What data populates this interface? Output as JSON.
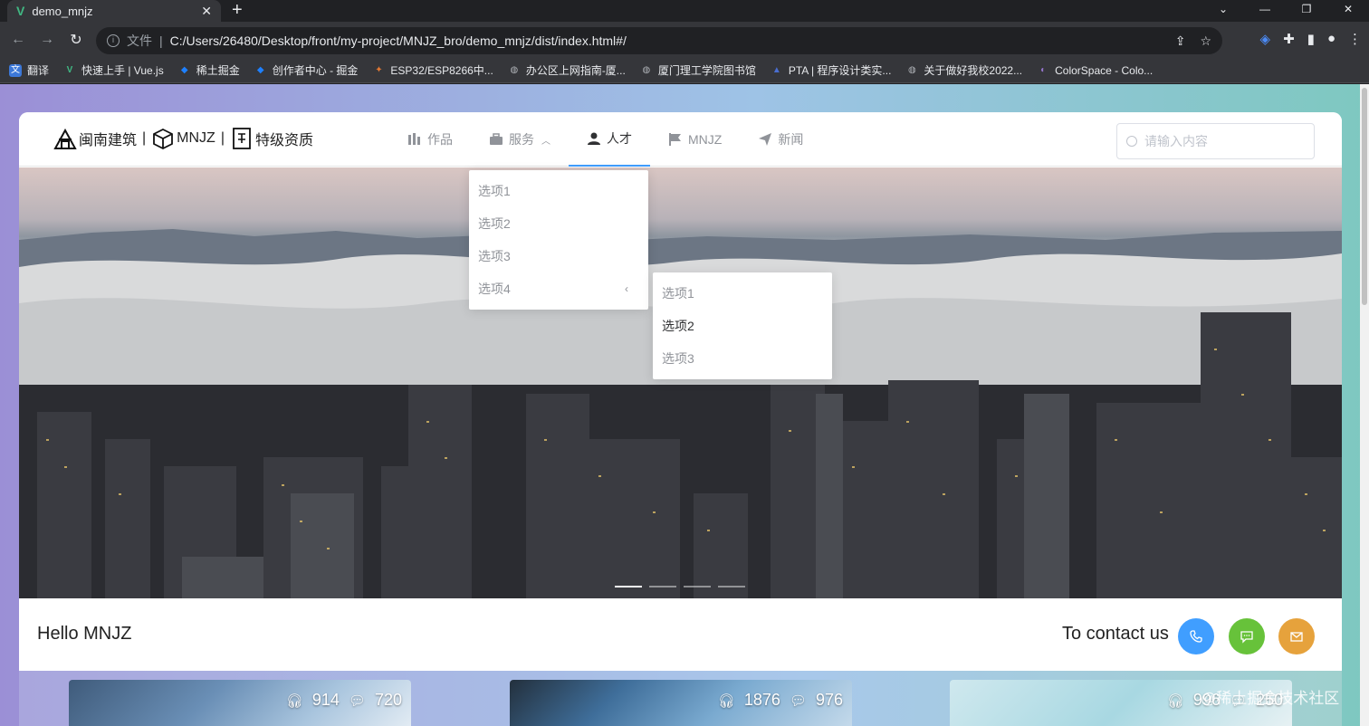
{
  "browser": {
    "tab_title": "demo_mnjz",
    "new_tab": "+",
    "omnibox_scheme": "文件",
    "url": "C:/Users/26480/Desktop/front/my-project/MNJZ_bro/demo_mnjz/dist/index.html#/",
    "bookmarks": [
      {
        "label": "翻译",
        "color": "#3c78d8"
      },
      {
        "label": "快速上手 | Vue.js",
        "color": "#41b883"
      },
      {
        "label": "稀土掘金",
        "color": "#1e80ff"
      },
      {
        "label": "创作者中心 - 掘金",
        "color": "#1e80ff"
      },
      {
        "label": "ESP32/ESP8266中...",
        "color": "#e37933"
      },
      {
        "label": "办公区上网指南-厦...",
        "color": "#8a8d91"
      },
      {
        "label": "厦门理工学院图书馆",
        "color": "#8a8d91"
      },
      {
        "label": "PTA | 程序设计类实...",
        "color": "#1a3f8a"
      },
      {
        "label": "关于做好我校2022...",
        "color": "#8a8d91"
      },
      {
        "label": "ColorSpace - Colo...",
        "color": "#7e57c2"
      }
    ]
  },
  "site": {
    "brand": {
      "part1": "闽南建筑",
      "separator": "|",
      "part2": "MNJZ",
      "part3": "特级资质"
    },
    "menu": [
      {
        "label": "作品"
      },
      {
        "label": "服务"
      },
      {
        "label": "人才"
      },
      {
        "label": "MNJZ"
      },
      {
        "label": "新闻"
      }
    ],
    "search_placeholder": "请输入内容",
    "submenu": [
      "选项1",
      "选项2",
      "选项3",
      "选项4"
    ],
    "submenu_nested": [
      "选项1",
      "选项2",
      "选项3"
    ],
    "carousel": {
      "slides": 4,
      "active": 1
    },
    "hello": "Hello MNJZ",
    "contact": "To contact us",
    "accent": "#409eff",
    "contact_colors": {
      "phone": "#409eff",
      "chat": "#67c23a",
      "mail": "#e6a23c"
    },
    "gallery": [
      {
        "listens": "914",
        "comments": "720"
      },
      {
        "listens": "1876",
        "comments": "976"
      },
      {
        "listens": "996",
        "comments": "250"
      }
    ],
    "watermark": "@稀土掘金技术社区"
  }
}
